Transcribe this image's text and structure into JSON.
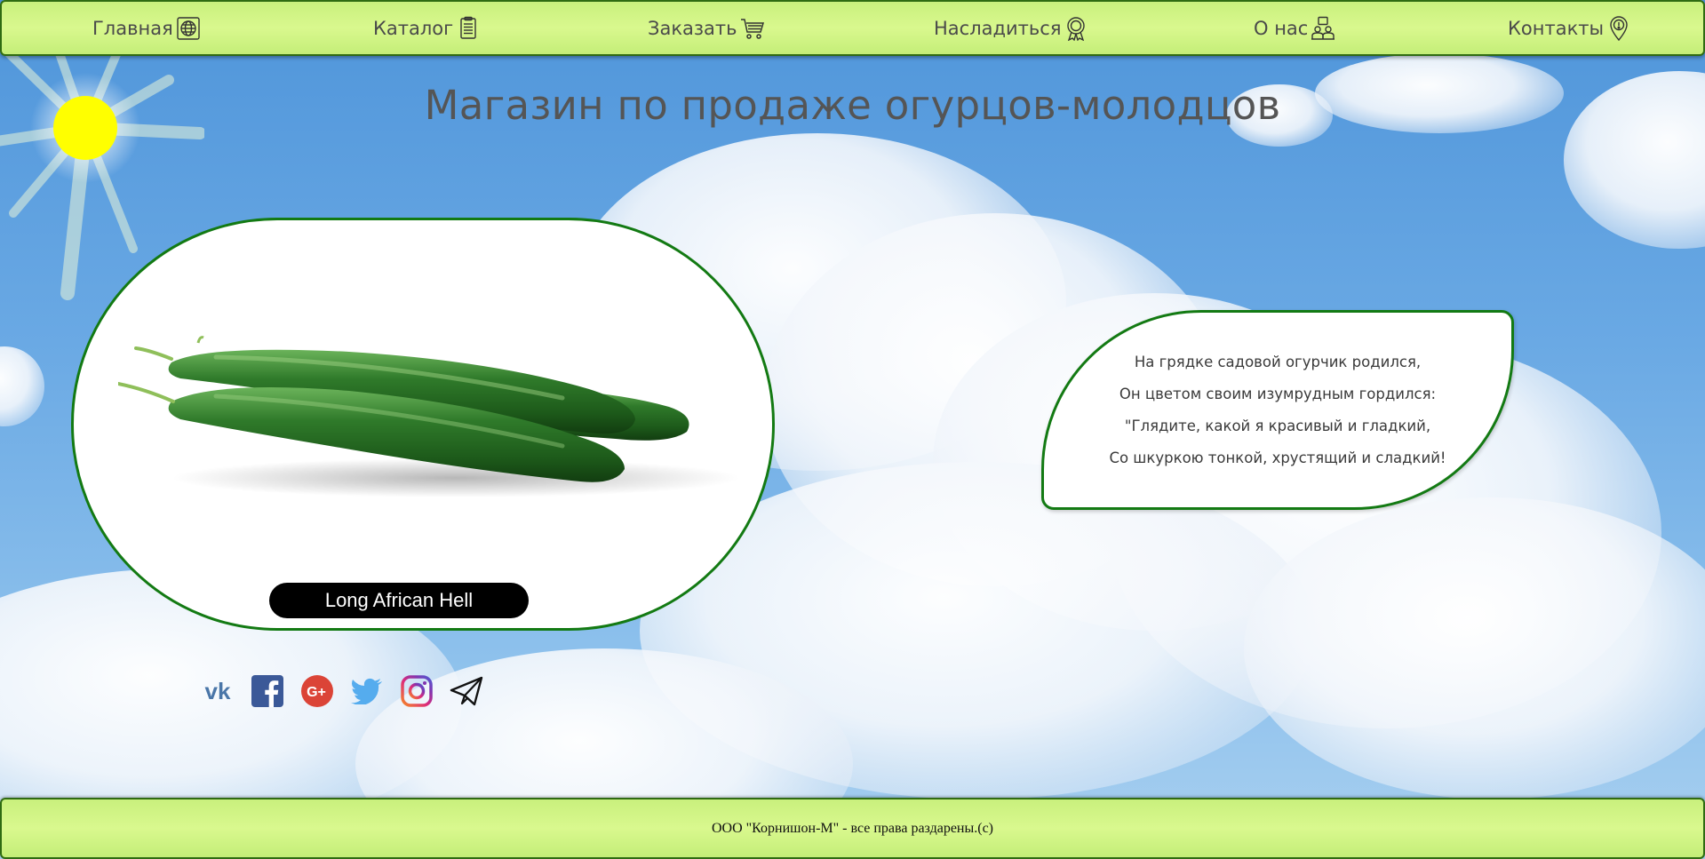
{
  "nav": {
    "items": [
      {
        "label": "Главная",
        "icon": "globe-icon"
      },
      {
        "label": "Каталог",
        "icon": "catalog-icon"
      },
      {
        "label": "Заказать",
        "icon": "cart-icon"
      },
      {
        "label": "Насладиться",
        "icon": "medal-icon"
      },
      {
        "label": "О нас",
        "icon": "people-icon"
      },
      {
        "label": "Контакты",
        "icon": "location-pin-icon"
      }
    ]
  },
  "page": {
    "title": "Магазин по продаже огурцов-молодцов"
  },
  "product": {
    "caption": "Long African Hell"
  },
  "poem": {
    "lines": [
      "На грядке садовой огурчик родился,",
      "Он цветом своим изумрудным гордился:",
      "\"Глядите, какой я красивый и гладкий,",
      "Со шкуркою тонкой, хрустящий и сладкий!"
    ]
  },
  "social": {
    "icons": [
      "vk-icon",
      "facebook-icon",
      "google-plus-icon",
      "twitter-icon",
      "instagram-icon",
      "telegram-icon"
    ]
  },
  "footer": {
    "text": "ООО \"Корнишон-М\" - все права раздарены.(c)"
  },
  "colors": {
    "nav_bg": "#d9f88e",
    "border_green": "#137a13",
    "sun": "#ffff00",
    "sky": "#6aa9e4"
  }
}
